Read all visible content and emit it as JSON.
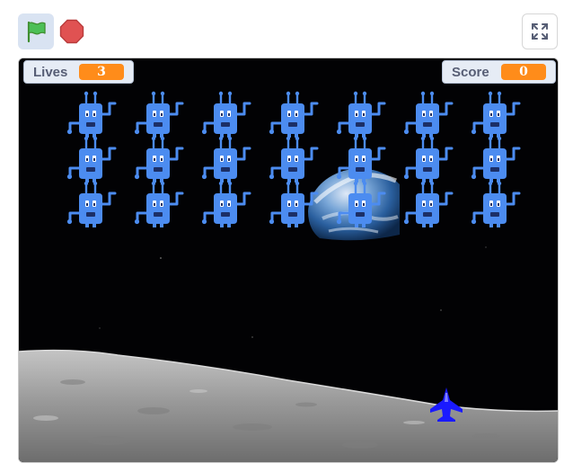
{
  "toolbar": {
    "green_flag_icon": "green-flag-icon",
    "stop_icon": "stop-sign-icon",
    "fullscreen_icon": "fullscreen-expand-icon"
  },
  "monitors": {
    "lives": {
      "label": "Lives",
      "value": "3"
    },
    "score": {
      "label": "Score",
      "value": "0"
    }
  },
  "game": {
    "invader_grid": {
      "rows": 3,
      "columns": 7
    },
    "player_ship_icon": "fighter-jet-icon",
    "background": "earthrise-over-moon"
  },
  "colors": {
    "invader": "#4c8cf0",
    "player_ship": "#1a1aff",
    "monitor_value": "#ff8c1a",
    "flag_button_bg": "#d9e3f2",
    "stop_red": "#e05252"
  }
}
